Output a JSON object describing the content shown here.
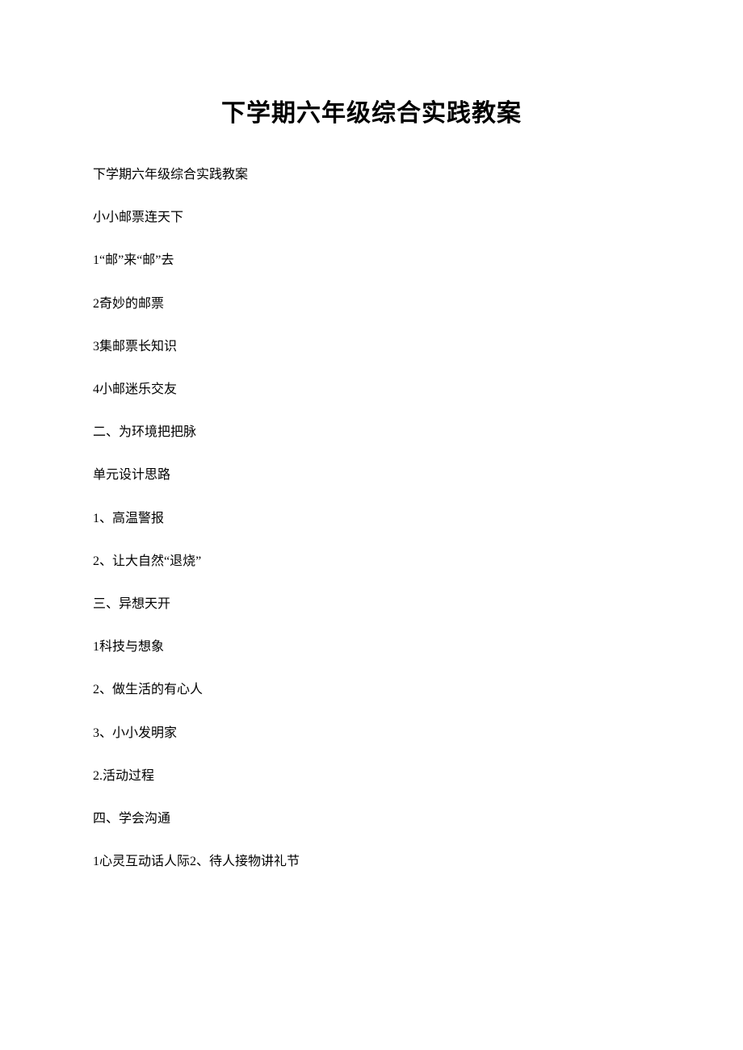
{
  "title": "下学期六年级综合实践教案",
  "lines": [
    "下学期六年级综合实践教案",
    "小小邮票连天下",
    "1“邮”来“邮”去",
    "2奇妙的邮票",
    "3集邮票长知识",
    "4小邮迷乐交友",
    "二、为环境把把脉",
    "单元设计思路",
    "1、高温警报",
    "2、让大自然“退烧”",
    "三、异想天开",
    "1科技与想象",
    "2、做生活的有心人",
    "3、小小发明家",
    "2.活动过程",
    "四、学会沟通",
    "1心灵互动话人际2、待人接物讲礼节"
  ]
}
